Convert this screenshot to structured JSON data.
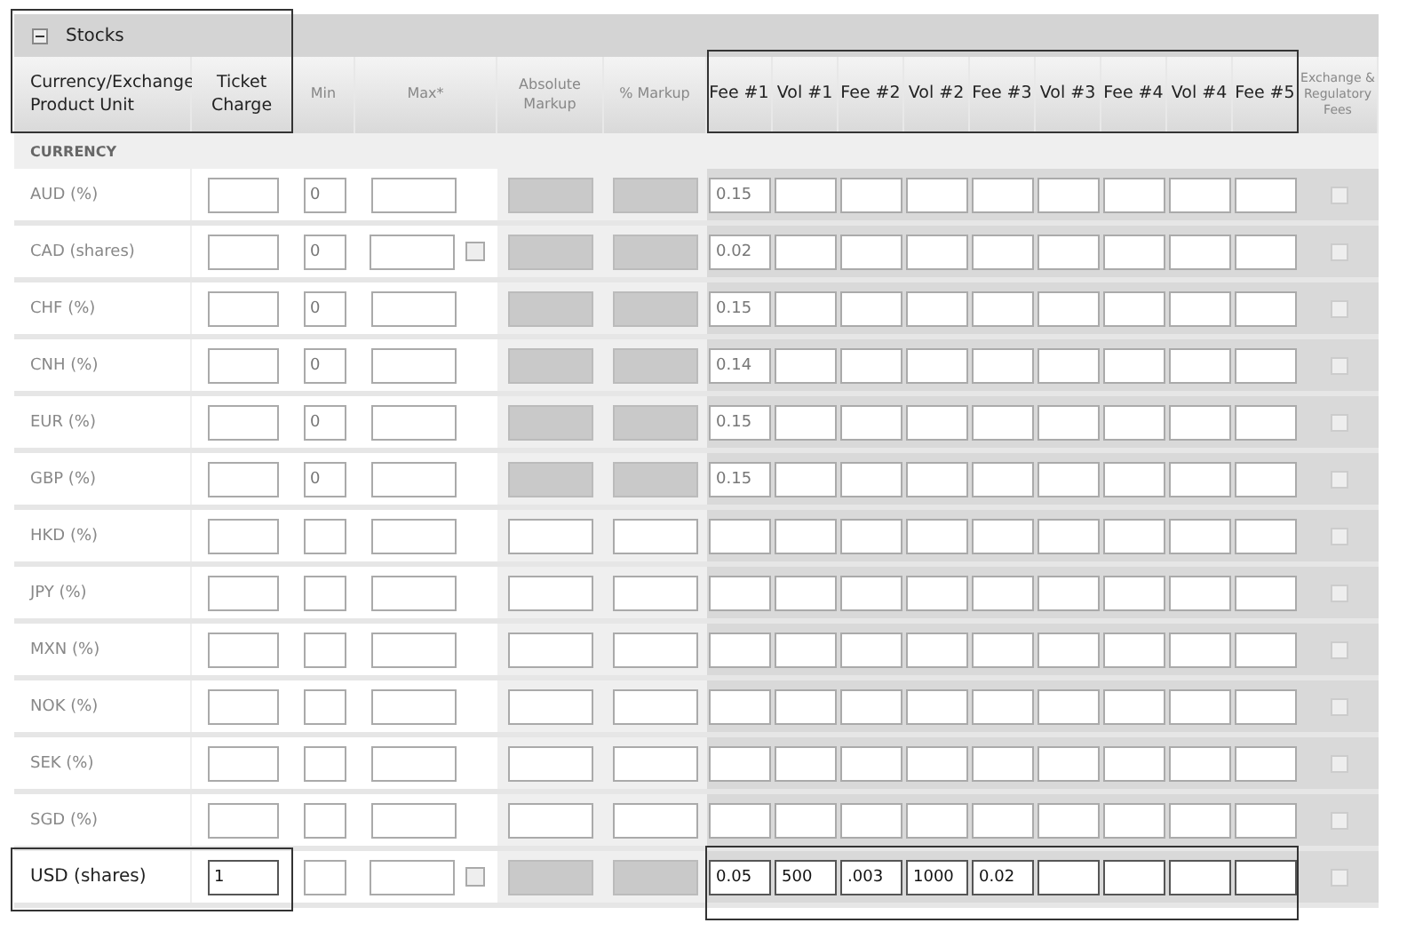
{
  "panel": {
    "title": "Stocks",
    "expanded": true
  },
  "columns": [
    "Currency/Exchange Product Unit",
    "Ticket Charge",
    "Min",
    "Max*",
    "Absolute Markup",
    "% Markup",
    "Fee #1",
    "Vol #1",
    "Fee #2",
    "Vol #2",
    "Fee #3",
    "Vol #3",
    "Fee #4",
    "Vol #4",
    "Fee #5",
    "Exchange & Regulatory Fees"
  ],
  "section": "CURRENCY",
  "rows": [
    {
      "label": "AUD (%)",
      "min": "0",
      "max_option": false,
      "markup_disabled": true,
      "fees": [
        "0.15"
      ],
      "exchange_checked": false
    },
    {
      "label": "CAD (shares)",
      "min": "0",
      "max_option": true,
      "markup_disabled": true,
      "fees": [
        "0.02"
      ],
      "exchange_checked": false
    },
    {
      "label": "CHF (%)",
      "min": "0",
      "max_option": false,
      "markup_disabled": true,
      "fees": [
        "0.15"
      ],
      "exchange_checked": false
    },
    {
      "label": "CNH (%)",
      "min": "0",
      "max_option": false,
      "markup_disabled": true,
      "fees": [
        "0.14"
      ],
      "exchange_checked": false
    },
    {
      "label": "EUR (%)",
      "min": "0",
      "max_option": false,
      "markup_disabled": true,
      "fees": [
        "0.15"
      ],
      "exchange_checked": false
    },
    {
      "label": "GBP (%)",
      "min": "0",
      "max_option": false,
      "markup_disabled": true,
      "fees": [
        "0.15"
      ],
      "exchange_checked": false
    },
    {
      "label": "HKD (%)",
      "max_option": false,
      "markup_disabled": false,
      "fees": [],
      "exchange_checked": false
    },
    {
      "label": "JPY (%)",
      "max_option": false,
      "markup_disabled": false,
      "fees": [],
      "exchange_checked": false
    },
    {
      "label": "MXN (%)",
      "max_option": false,
      "markup_disabled": false,
      "fees": [],
      "exchange_checked": false
    },
    {
      "label": "NOK (%)",
      "max_option": false,
      "markup_disabled": false,
      "fees": [],
      "exchange_checked": false
    },
    {
      "label": "SEK (%)",
      "max_option": false,
      "markup_disabled": false,
      "fees": [],
      "exchange_checked": false
    },
    {
      "label": "SGD (%)",
      "max_option": false,
      "markup_disabled": false,
      "fees": [],
      "exchange_checked": false
    },
    {
      "label": "USD (shares)",
      "ticket": "1",
      "max_option": true,
      "markup_disabled": true,
      "fees": [
        "0.05",
        "500",
        ".003",
        "1000",
        "0.02"
      ],
      "exchange_checked": false,
      "highlighted": true
    }
  ]
}
